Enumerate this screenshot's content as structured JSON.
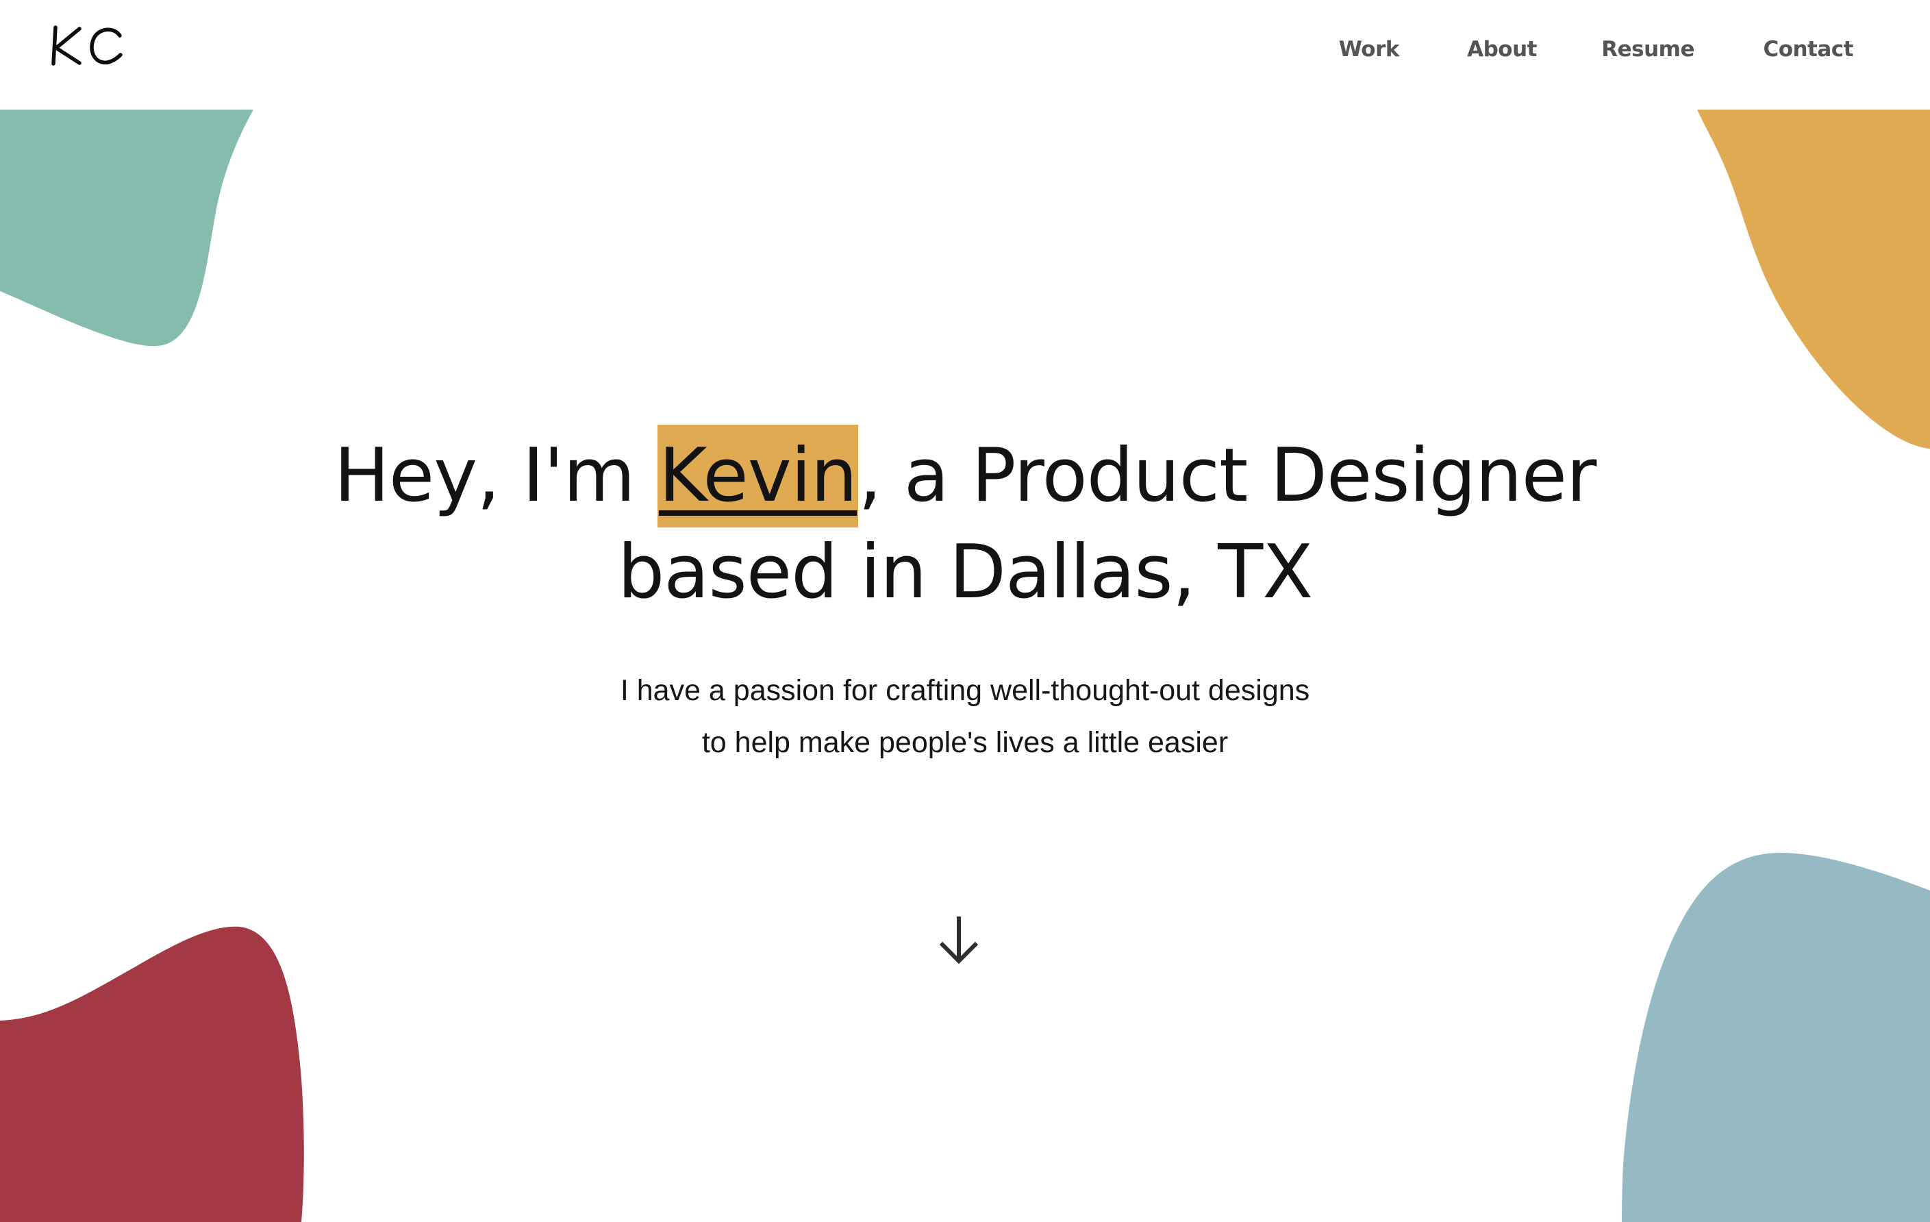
{
  "header": {
    "logo_text": "KC",
    "nav": [
      {
        "label": "Work"
      },
      {
        "label": "About"
      },
      {
        "label": "Resume"
      },
      {
        "label": "Contact"
      }
    ]
  },
  "hero": {
    "title_prefix": "Hey, I'm ",
    "title_name": "Kevin",
    "title_suffix": ", a Product Designer",
    "title_line2": "based in Dallas, TX",
    "subtitle_line1": "I have a passion for crafting well-thought-out designs",
    "subtitle_line2": "to help make people's lives a little easier"
  },
  "scroll": {
    "icon": "arrow-down-icon"
  },
  "colors": {
    "teal": "#85bcad",
    "gold": "#e0aa52",
    "red": "#a33944",
    "blue": "#95bac4",
    "text": "#131313",
    "nav_text": "#545454",
    "highlight": "#e0aa52"
  }
}
